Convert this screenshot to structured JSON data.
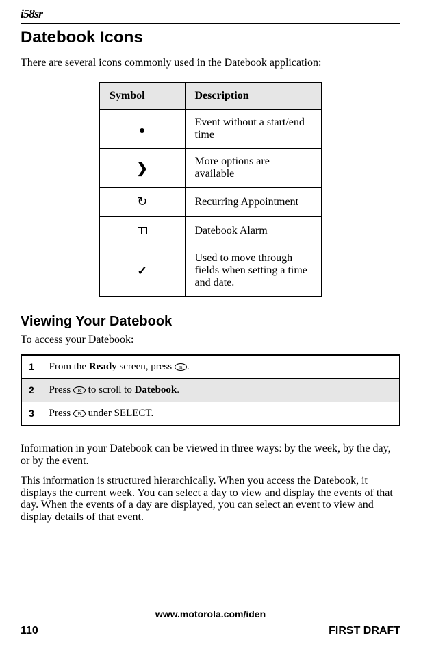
{
  "header": {
    "model": "i58sr"
  },
  "section1": {
    "title": "Datebook Icons",
    "intro": "There are several icons commonly used in the Datebook application:"
  },
  "symbolTable": {
    "headers": {
      "symbol": "Symbol",
      "description": "Description"
    },
    "rows": [
      {
        "iconName": "dot-icon",
        "desc": "Event without a start/end time"
      },
      {
        "iconName": "chevron-right-icon",
        "desc": "More options are available"
      },
      {
        "iconName": "recurring-icon",
        "desc": "Recurring Appointment"
      },
      {
        "iconName": "alarm-icon",
        "desc": "Datebook Alarm"
      },
      {
        "iconName": "checkmark-icon",
        "desc": "Used to move through fields when setting a time and date."
      }
    ]
  },
  "section2": {
    "title": "Viewing Your Datebook",
    "lead": "To access your Datebook:"
  },
  "steps": {
    "rows": [
      {
        "num": "1",
        "prefix": "From the ",
        "bold1": "Ready",
        "mid": " screen, press ",
        "key": "m",
        "suffix": "."
      },
      {
        "num": "2",
        "prefix": "Press ",
        "key": "R",
        "mid": " to scroll to ",
        "bold1": "Datebook",
        "suffix": "."
      },
      {
        "num": "3",
        "prefix": "Press ",
        "key": "B",
        "mid": " under SELECT.",
        "bold1": "",
        "suffix": ""
      }
    ]
  },
  "paragraphs": {
    "p1": "Information in your Datebook can be viewed in three ways: by the week, by the day, or by the event.",
    "p2": "This information is structured hierarchically. When you access the Datebook, it displays the current week. You can select a day to view and display the events of that day. When the events of a day are displayed, you can select an event to view and display details of that event."
  },
  "footer": {
    "url": "www.motorola.com/iden",
    "pageNum": "110",
    "draft": "FIRST DRAFT"
  }
}
